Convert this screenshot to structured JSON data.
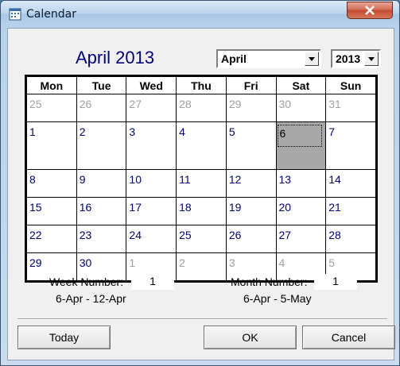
{
  "window": {
    "title": "Calendar",
    "icon": "calendar-icon"
  },
  "header": {
    "month_title": "April 2013",
    "month_select": "April",
    "year_select": "2013"
  },
  "calendar": {
    "weekdays": [
      "Mon",
      "Tue",
      "Wed",
      "Thu",
      "Fri",
      "Sat",
      "Sun"
    ],
    "weeks": [
      [
        {
          "d": "25",
          "o": true
        },
        {
          "d": "26",
          "o": true
        },
        {
          "d": "27",
          "o": true
        },
        {
          "d": "28",
          "o": true
        },
        {
          "d": "29",
          "o": true
        },
        {
          "d": "30",
          "o": true
        },
        {
          "d": "31",
          "o": true
        }
      ],
      [
        {
          "d": "1"
        },
        {
          "d": "2"
        },
        {
          "d": "3"
        },
        {
          "d": "4"
        },
        {
          "d": "5"
        },
        {
          "d": "6",
          "sel": true
        },
        {
          "d": "7"
        }
      ],
      [
        {
          "d": "8"
        },
        {
          "d": "9"
        },
        {
          "d": "10"
        },
        {
          "d": "11"
        },
        {
          "d": "12"
        },
        {
          "d": "13"
        },
        {
          "d": "14"
        }
      ],
      [
        {
          "d": "15"
        },
        {
          "d": "16"
        },
        {
          "d": "17"
        },
        {
          "d": "18"
        },
        {
          "d": "19"
        },
        {
          "d": "20"
        },
        {
          "d": "21"
        }
      ],
      [
        {
          "d": "22"
        },
        {
          "d": "23"
        },
        {
          "d": "24"
        },
        {
          "d": "25"
        },
        {
          "d": "26"
        },
        {
          "d": "27"
        },
        {
          "d": "28"
        }
      ],
      [
        {
          "d": "29"
        },
        {
          "d": "30"
        },
        {
          "d": "1",
          "o": true
        },
        {
          "d": "2",
          "o": true
        },
        {
          "d": "3",
          "o": true
        },
        {
          "d": "4",
          "o": true
        },
        {
          "d": "5",
          "o": true
        }
      ]
    ]
  },
  "info": {
    "week_label": "Week Number:",
    "week_value": "1",
    "week_range": "6-Apr - 12-Apr",
    "month_label": "Month Number:",
    "month_value": "1",
    "month_range": "6-Apr - 5-May"
  },
  "buttons": {
    "today": "Today",
    "ok": "OK",
    "cancel": "Cancel"
  },
  "colors": {
    "current_month_text": "#000080",
    "other_month_text": "#a0a0a0",
    "selected_bg": "#a8a8a8"
  }
}
